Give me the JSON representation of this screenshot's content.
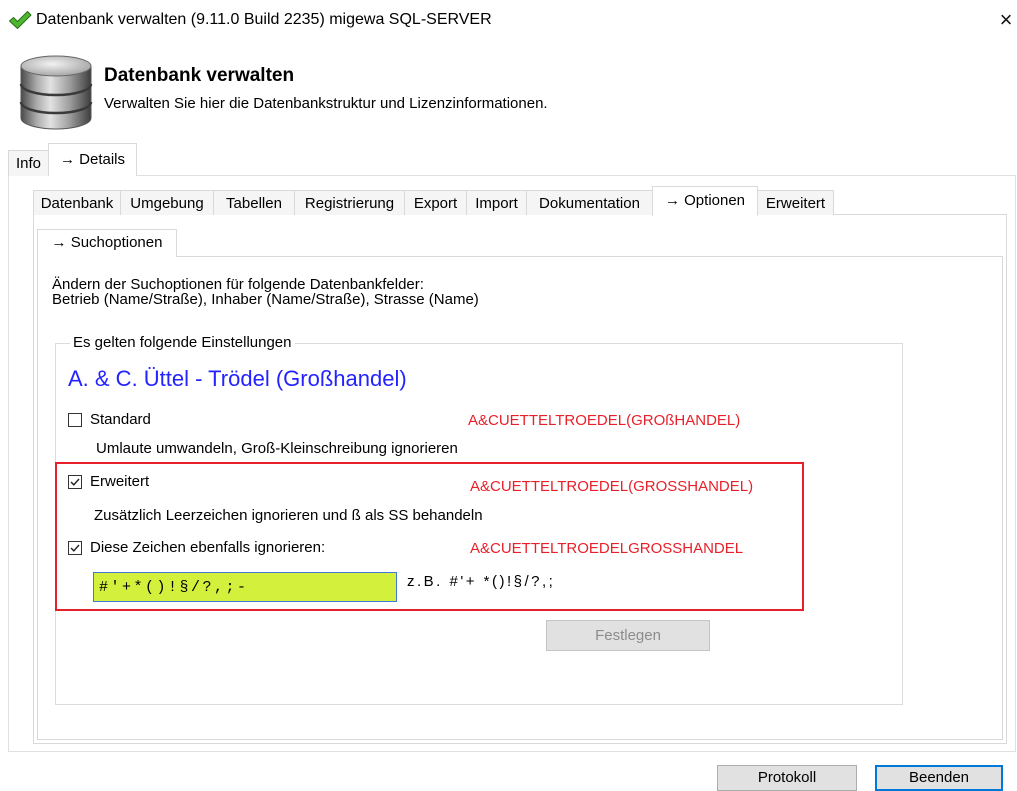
{
  "window": {
    "title": "Datenbank verwalten (9.11.0 Build 2235) migewa SQL-SERVER",
    "close_label": "×",
    "icon": "checkmark-icon"
  },
  "header": {
    "title": "Datenbank verwalten",
    "subtitle": "Verwalten Sie hier die Datenbankstruktur und Lizenzinformationen.",
    "icon": "database-icon"
  },
  "main_tabs": [
    {
      "label": "Info",
      "selected": false
    },
    {
      "label": "→ Details",
      "selected": true
    }
  ],
  "detail_tabs": [
    {
      "label": "Datenbank",
      "selected": false
    },
    {
      "label": "Umgebung",
      "selected": false
    },
    {
      "label": "Tabellen",
      "selected": false
    },
    {
      "label": "Registrierung",
      "selected": false
    },
    {
      "label": "Export",
      "selected": false
    },
    {
      "label": "Import",
      "selected": false
    },
    {
      "label": "Dokumentation",
      "selected": false
    },
    {
      "label": "→ Optionen",
      "selected": true
    },
    {
      "label": "Erweitert",
      "selected": false
    }
  ],
  "option_tabs": [
    {
      "label": "→ Suchoptionen",
      "selected": true
    }
  ],
  "search_options": {
    "description": [
      "Ändern der Suchoptionen für folgende Datenbankfelder:",
      "Betrieb (Name/Straße), Inhaber (Name/Straße), Strasse (Name)"
    ],
    "group_title": "Es gelten folgende Einstellungen",
    "sample_name": "A. & C. Üttel - Trödel (Großhandel)",
    "modes": [
      {
        "label": "Standard",
        "checked": false,
        "result": "A&CUETTELTROEDEL(GROßHANDEL)",
        "hint": "Umlaute umwandeln, Groß-Kleinschreibung ignorieren"
      },
      {
        "label": "Erweitert",
        "checked": true,
        "result": "A&CUETTELTROEDEL(GROSSHANDEL)",
        "hint": "Zusätzlich Leerzeichen ignorieren und ß als SS behandeln"
      },
      {
        "label": "Diese Zeichen ebenfalls ignorieren:",
        "checked": true,
        "result": "A&CUETTELTROEDELGROSSHANDEL"
      }
    ],
    "ignore_chars": {
      "value": "#'+*()!§/?,;-",
      "example": "z.B. #'+ *()!§/?,;"
    },
    "apply_button": {
      "label": "Festlegen",
      "enabled": false
    }
  },
  "footer": {
    "buttons": [
      {
        "label": "Protokoll"
      },
      {
        "label": "Beenden",
        "default": true
      }
    ]
  },
  "colors": {
    "result_text": "#e8202a",
    "highlight_border": "#e8202a",
    "sample_name": "#2323ff",
    "ignore_input_background": "#d2f03c",
    "ignore_input_border": "#3f7ad8",
    "default_button_border": "#0078d7",
    "checkmark_green": "#4cb82e"
  }
}
